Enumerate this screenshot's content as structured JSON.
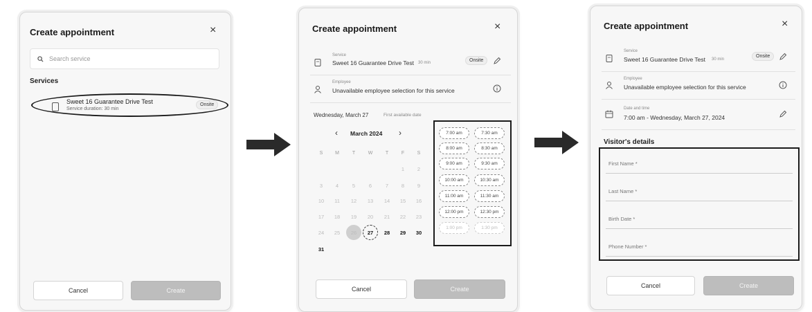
{
  "panel1": {
    "title": "Create appointment",
    "search_placeholder": "Search service",
    "section": "Services",
    "service": {
      "name": "Sweet 16 Guarantee Drive Test",
      "duration": "Service duration: 30 min",
      "badge": "Onsite"
    },
    "cancel": "Cancel",
    "create": "Create"
  },
  "panel2": {
    "title": "Create appointment",
    "service_label": "Service",
    "service_value": "Sweet 16 Guarantee Drive Test",
    "service_duration": "30 min",
    "service_badge": "Onsite",
    "employee_label": "Employee",
    "employee_value": "Unavailable employee selection for this service",
    "selected_date": "Wednesday, March 27",
    "first_available": "First available date",
    "month": "March 2024",
    "weekdays": [
      "S",
      "M",
      "T",
      "W",
      "T",
      "F",
      "S"
    ],
    "days": {
      "d1": "1",
      "d2": "2",
      "d3": "3",
      "d4": "4",
      "d5": "5",
      "d6": "6",
      "d7": "7",
      "d8": "8",
      "d9": "9",
      "d10": "10",
      "d11": "11",
      "d12": "12",
      "d13": "13",
      "d14": "14",
      "d15": "15",
      "d16": "16",
      "d17": "17",
      "d18": "18",
      "d19": "19",
      "d20": "20",
      "d21": "21",
      "d22": "22",
      "d23": "23",
      "d24": "24",
      "d25": "25",
      "d26": "26",
      "d27": "27",
      "d28": "28",
      "d29": "29",
      "d30": "30",
      "d31": "31"
    },
    "slots": [
      "7:00 am",
      "7:30 am",
      "8:00 am",
      "8:30 am",
      "9:00 am",
      "9:30 am",
      "10:00 am",
      "10:30 am",
      "11:00 am",
      "11:30 am",
      "12:00 pm",
      "12:30 pm",
      "1:00 pm",
      "1:30 pm"
    ],
    "cancel": "Cancel",
    "create": "Create"
  },
  "panel3": {
    "title": "Create appointment",
    "service_label": "Service",
    "service_value": "Sweet 16 Guarantee Drive Test",
    "service_duration": "30 min",
    "service_badge": "Onsite",
    "employee_label": "Employee",
    "employee_value": "Unavailable employee selection for this service",
    "datetime_label": "Date and time",
    "datetime_value": "7:00 am - Wednesday, March 27, 2024",
    "visitor_heading": "Visitor's details",
    "fields": [
      "First Name *",
      "Last Name *",
      "Birth Date *",
      "Phone Number *"
    ],
    "cancel": "Cancel",
    "create": "Create"
  },
  "close_symbol": "×",
  "colors": {
    "highlight": "#1b1b1b",
    "disabled_button": "#bdbdbd",
    "panel_bg": "#f7f7f7"
  }
}
